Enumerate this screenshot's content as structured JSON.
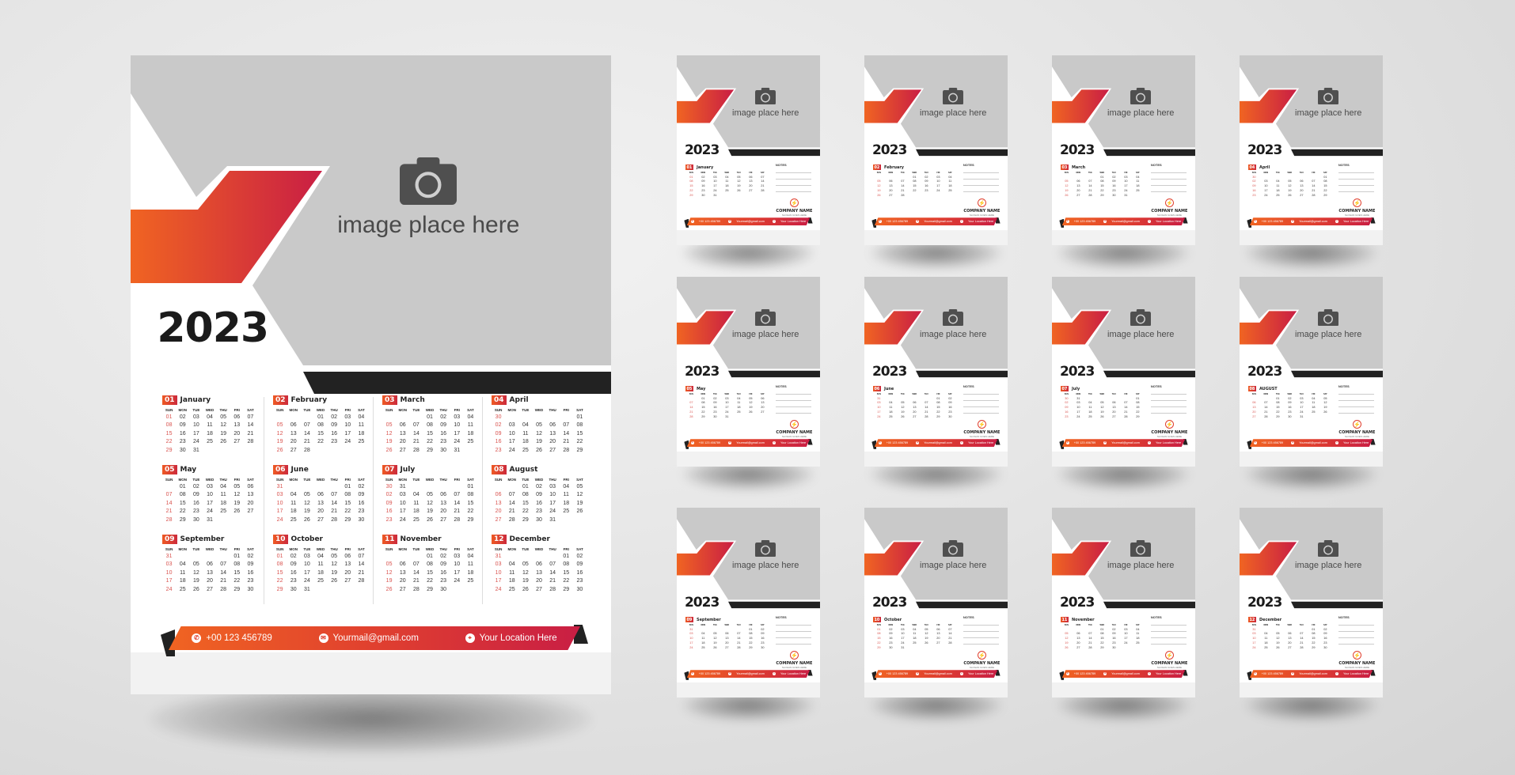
{
  "year": "2023",
  "placeholder_text": "image place here",
  "placeholder_icon": "camera-icon",
  "weekday_headers": [
    "SUN",
    "MON",
    "TUE",
    "WED",
    "THU",
    "FRI",
    "SAT"
  ],
  "contact": {
    "phone": "+00 123 456789",
    "email": "Yourmail@gmail.com",
    "location": "Your Location Here",
    "phone_icon": "phone-icon",
    "email_icon": "mail-icon",
    "location_icon": "location-pin-icon"
  },
  "notes_label": "NOTES",
  "company": {
    "name": "COMPANY NAME",
    "slogan": "SLOGAN GOES HERE",
    "logo_icon": "lightning-logo-icon"
  },
  "colors": {
    "accent_start": "#f06422",
    "accent_end": "#c91e44",
    "photo_gray": "#c9c9c9",
    "dark_bar": "#222222",
    "sunday": "#d9534f"
  },
  "months": [
    {
      "num": "01",
      "name": "January",
      "small_name": "January",
      "rows": [
        [
          "01",
          "02",
          "03",
          "04",
          "05",
          "06",
          "07"
        ],
        [
          "08",
          "09",
          "10",
          "11",
          "12",
          "13",
          "14"
        ],
        [
          "15",
          "16",
          "17",
          "18",
          "19",
          "20",
          "21"
        ],
        [
          "22",
          "23",
          "24",
          "25",
          "26",
          "27",
          "28"
        ],
        [
          "29",
          "30",
          "31",
          "",
          "",
          "",
          ""
        ]
      ]
    },
    {
      "num": "02",
      "name": "February",
      "small_name": "February",
      "rows": [
        [
          "",
          "",
          "",
          "01",
          "02",
          "03",
          "04"
        ],
        [
          "05",
          "06",
          "07",
          "08",
          "09",
          "10",
          "11"
        ],
        [
          "12",
          "13",
          "14",
          "15",
          "16",
          "17",
          "18"
        ],
        [
          "19",
          "20",
          "21",
          "22",
          "23",
          "24",
          "25"
        ],
        [
          "26",
          "27",
          "28",
          "",
          "",
          "",
          ""
        ]
      ]
    },
    {
      "num": "03",
      "name": "March",
      "small_name": "March",
      "rows": [
        [
          "",
          "",
          "",
          "01",
          "02",
          "03",
          "04"
        ],
        [
          "05",
          "06",
          "07",
          "08",
          "09",
          "10",
          "11"
        ],
        [
          "12",
          "13",
          "14",
          "15",
          "16",
          "17",
          "18"
        ],
        [
          "19",
          "20",
          "21",
          "22",
          "23",
          "24",
          "25"
        ],
        [
          "26",
          "27",
          "28",
          "29",
          "30",
          "31",
          ""
        ]
      ]
    },
    {
      "num": "04",
      "name": "April",
      "small_name": "April",
      "rows": [
        [
          "30",
          "",
          "",
          "",
          "",
          "",
          "01"
        ],
        [
          "02",
          "03",
          "04",
          "05",
          "06",
          "07",
          "08"
        ],
        [
          "09",
          "10",
          "11",
          "12",
          "13",
          "14",
          "15"
        ],
        [
          "16",
          "17",
          "18",
          "19",
          "20",
          "21",
          "22"
        ],
        [
          "23",
          "24",
          "25",
          "26",
          "27",
          "28",
          "29"
        ]
      ]
    },
    {
      "num": "05",
      "name": "May",
      "small_name": "May",
      "rows": [
        [
          "",
          "01",
          "02",
          "03",
          "04",
          "05",
          "06"
        ],
        [
          "07",
          "08",
          "09",
          "10",
          "11",
          "12",
          "13"
        ],
        [
          "14",
          "15",
          "16",
          "17",
          "18",
          "19",
          "20"
        ],
        [
          "21",
          "22",
          "23",
          "24",
          "25",
          "26",
          "27"
        ],
        [
          "28",
          "29",
          "30",
          "31",
          "",
          "",
          ""
        ]
      ]
    },
    {
      "num": "06",
      "name": "June",
      "small_name": "June",
      "rows": [
        [
          "31",
          "",
          "",
          "",
          "",
          "01",
          "02"
        ],
        [
          "03",
          "04",
          "05",
          "06",
          "07",
          "08",
          "09"
        ],
        [
          "10",
          "11",
          "12",
          "13",
          "14",
          "15",
          "16"
        ],
        [
          "17",
          "18",
          "19",
          "20",
          "21",
          "22",
          "23"
        ],
        [
          "24",
          "25",
          "26",
          "27",
          "28",
          "29",
          "30"
        ]
      ]
    },
    {
      "num": "07",
      "name": "July",
      "small_name": "July",
      "rows": [
        [
          "30",
          "31",
          "",
          "",
          "",
          "",
          "01"
        ],
        [
          "02",
          "03",
          "04",
          "05",
          "06",
          "07",
          "08"
        ],
        [
          "09",
          "10",
          "11",
          "12",
          "13",
          "14",
          "15"
        ],
        [
          "16",
          "17",
          "18",
          "19",
          "20",
          "21",
          "22"
        ],
        [
          "23",
          "24",
          "25",
          "26",
          "27",
          "28",
          "29"
        ]
      ]
    },
    {
      "num": "08",
      "name": "August",
      "small_name": "AUGUST",
      "rows": [
        [
          "",
          "",
          "01",
          "02",
          "03",
          "04",
          "05"
        ],
        [
          "06",
          "07",
          "08",
          "09",
          "10",
          "11",
          "12"
        ],
        [
          "13",
          "14",
          "15",
          "16",
          "17",
          "18",
          "19"
        ],
        [
          "20",
          "21",
          "22",
          "23",
          "24",
          "25",
          "26"
        ],
        [
          "27",
          "28",
          "29",
          "30",
          "31",
          "",
          ""
        ]
      ]
    },
    {
      "num": "09",
      "name": "September",
      "small_name": "September",
      "rows": [
        [
          "31",
          "",
          "",
          "",
          "",
          "01",
          "02"
        ],
        [
          "03",
          "04",
          "05",
          "06",
          "07",
          "08",
          "09"
        ],
        [
          "10",
          "11",
          "12",
          "13",
          "14",
          "15",
          "16"
        ],
        [
          "17",
          "18",
          "19",
          "20",
          "21",
          "22",
          "23"
        ],
        [
          "24",
          "25",
          "26",
          "27",
          "28",
          "29",
          "30"
        ]
      ]
    },
    {
      "num": "10",
      "name": "October",
      "small_name": "October",
      "rows": [
        [
          "01",
          "02",
          "03",
          "04",
          "05",
          "06",
          "07"
        ],
        [
          "08",
          "09",
          "10",
          "11",
          "12",
          "13",
          "14"
        ],
        [
          "15",
          "16",
          "17",
          "18",
          "19",
          "20",
          "21"
        ],
        [
          "22",
          "23",
          "24",
          "25",
          "26",
          "27",
          "28"
        ],
        [
          "29",
          "30",
          "31",
          "",
          "",
          "",
          ""
        ]
      ]
    },
    {
      "num": "11",
      "name": "November",
      "small_name": "November",
      "rows": [
        [
          "",
          "",
          "",
          "01",
          "02",
          "03",
          "04"
        ],
        [
          "05",
          "06",
          "07",
          "08",
          "09",
          "10",
          "11"
        ],
        [
          "12",
          "13",
          "14",
          "15",
          "16",
          "17",
          "18"
        ],
        [
          "19",
          "20",
          "21",
          "22",
          "23",
          "24",
          "25"
        ],
        [
          "26",
          "27",
          "28",
          "29",
          "30",
          "",
          ""
        ]
      ]
    },
    {
      "num": "12",
      "name": "December",
      "small_name": "December",
      "rows": [
        [
          "31",
          "",
          "",
          "",
          "",
          "01",
          "02"
        ],
        [
          "03",
          "04",
          "05",
          "06",
          "07",
          "08",
          "09"
        ],
        [
          "10",
          "11",
          "12",
          "13",
          "14",
          "15",
          "16"
        ],
        [
          "17",
          "18",
          "19",
          "20",
          "21",
          "22",
          "23"
        ],
        [
          "24",
          "25",
          "26",
          "27",
          "28",
          "29",
          "30"
        ]
      ]
    }
  ]
}
